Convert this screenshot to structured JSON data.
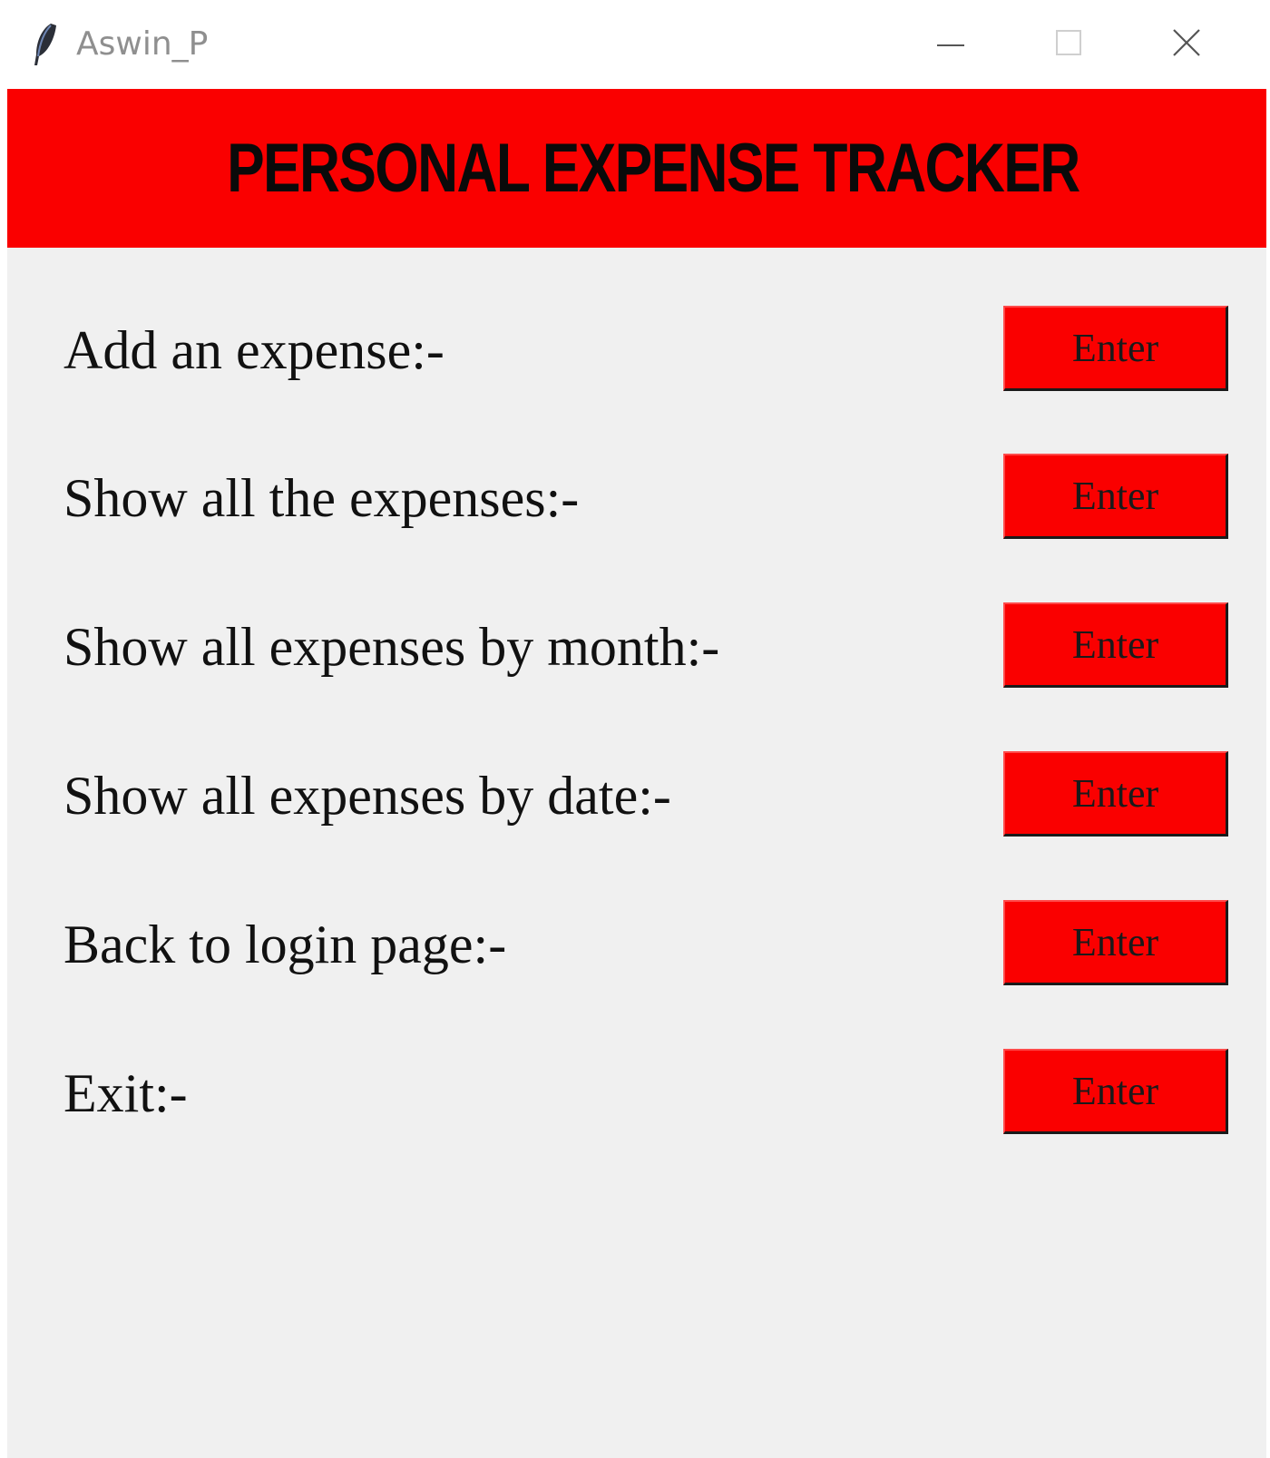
{
  "window": {
    "title": "Aswin_P",
    "app_icon": "feather-icon",
    "controls": {
      "minimize_icon": "minimize-icon",
      "maximize_icon": "maximize-icon",
      "close_icon": "close-icon"
    }
  },
  "header": {
    "title": "PERSONAL EXPENSE TRACKER",
    "background_color": "#fa0000",
    "text_color": "#0a0a0a"
  },
  "menu": {
    "items": [
      {
        "label": "Add an expense:-",
        "button_label": "Enter"
      },
      {
        "label": "Show all the expenses:-",
        "button_label": "Enter"
      },
      {
        "label": "Show all expenses by month:-",
        "button_label": "Enter"
      },
      {
        "label": "Show all expenses by date:-",
        "button_label": "Enter"
      },
      {
        "label": "Back to login page:-",
        "button_label": "Enter"
      },
      {
        "label": "Exit:-",
        "button_label": "Enter"
      }
    ]
  },
  "colors": {
    "button_background": "#fa0000",
    "window_background": "#f0f0f0"
  }
}
